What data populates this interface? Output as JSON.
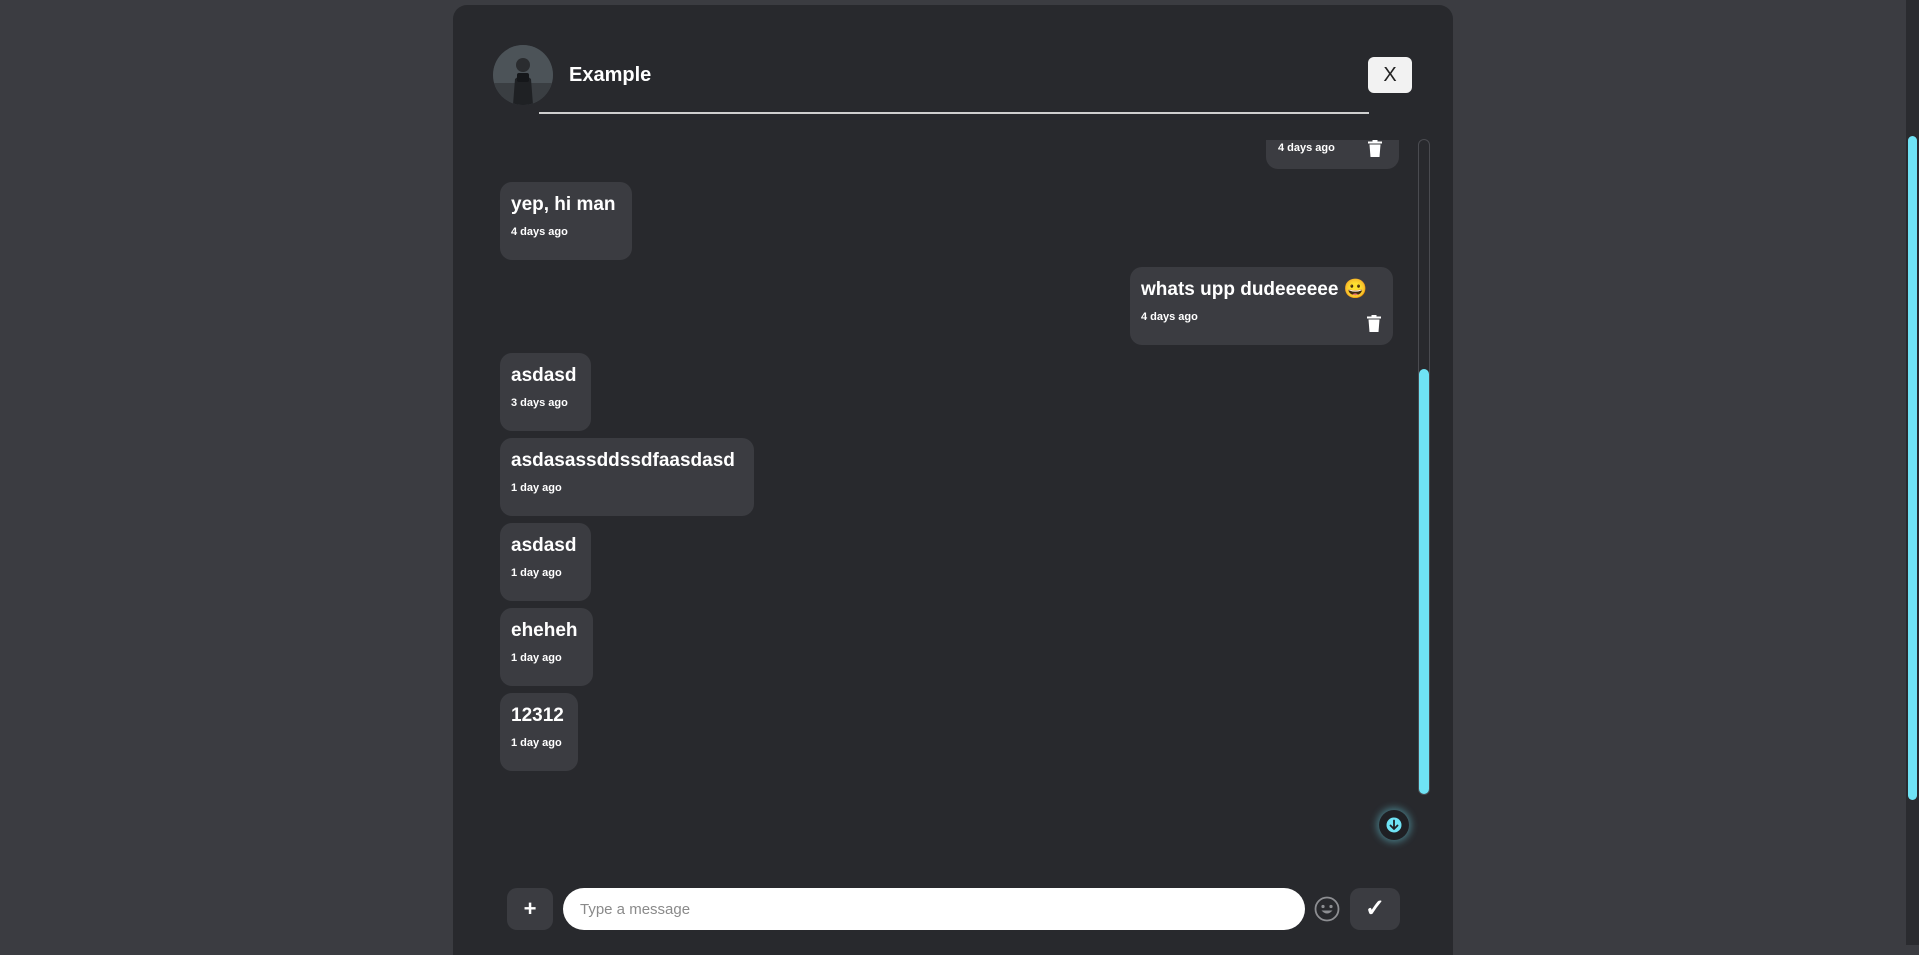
{
  "page": {
    "accent_color": "#6fe3f5",
    "background_color": "#3b3c41",
    "panel_color": "#28292d"
  },
  "header": {
    "avatar_icon": "profile-photo",
    "contact_name": "Example",
    "close_label": "X"
  },
  "messages": [
    {
      "direction": "sent",
      "text": "",
      "time": "4 days ago",
      "deletable": true
    },
    {
      "direction": "received",
      "text": "yep, hi man",
      "time": "4 days ago",
      "deletable": false
    },
    {
      "direction": "sent",
      "text": "whats upp dudeeeeee 😀",
      "time": "4 days ago",
      "deletable": true
    },
    {
      "direction": "received",
      "text": "asdasd",
      "time": "3 days ago",
      "deletable": false
    },
    {
      "direction": "received",
      "text": "asdasassddssdfaasdasd",
      "time": "1 day ago",
      "deletable": false
    },
    {
      "direction": "received",
      "text": "asdasd",
      "time": "1 day ago",
      "deletable": false
    },
    {
      "direction": "received",
      "text": "eheheh",
      "time": "1 day ago",
      "deletable": false
    },
    {
      "direction": "received",
      "text": "12312",
      "time": "1 day ago",
      "deletable": false
    }
  ],
  "composer": {
    "attach_label": "+",
    "input_value": "",
    "input_placeholder": "Type a message",
    "emoji_icon": "smiley-icon",
    "send_label": "✓"
  },
  "icons": {
    "delete": "trash-icon",
    "scroll_down": "arrow-down-icon"
  }
}
